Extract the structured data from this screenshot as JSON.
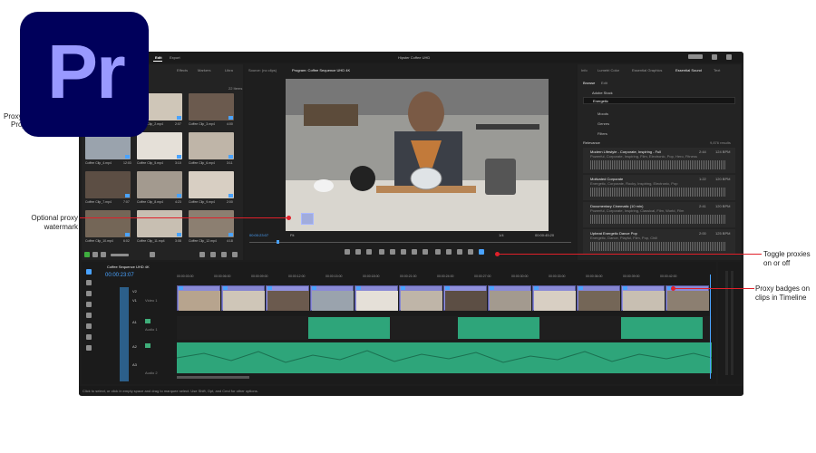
{
  "logo": {
    "text": "Pr"
  },
  "window": {
    "title": "Hipster Coffee UHD"
  },
  "header": {
    "tabs": [
      "Edit",
      "Export"
    ],
    "active_tab": "Edit"
  },
  "source_tabs": [
    "Effects",
    "Markers",
    "Libra"
  ],
  "program_tabs": [
    "Source: (no clips)",
    "Program: Coffee Sequence UHD 4K"
  ],
  "right_tabs": [
    "Info",
    "Lumetri Color",
    "Essential Graphics",
    "Essential Sound",
    "Text"
  ],
  "essential_sound": {
    "subtabs": [
      "Browse",
      "Edit"
    ],
    "filter": "Adobe Stock",
    "search": "Energetic",
    "filters": [
      "Moods",
      "Genres",
      "Filters"
    ],
    "results_label": "Relevance",
    "results_count": "9,876 results",
    "tracks": [
      {
        "title": "Modern Lifestyle - Corporate, Inspiring - Full",
        "sub": "Powerful, Corporate, Inspiring, Film, Electronic, Pop, Hero, Fitness",
        "dur": "2:44",
        "bpm": "124 BPM"
      },
      {
        "title": "Motivated Corporate",
        "sub": "Energetic, Corporate, Rocky, Inspiring, Electronic, Pop",
        "dur": "1:22",
        "bpm": "120 BPM"
      },
      {
        "title": "Documentary Cinematic (10 min)",
        "sub": "Powerful, Corporate, Inspiring, Classical, Film, World, Film",
        "dur": "2:41",
        "bpm": "120 BPM"
      },
      {
        "title": "Upbeat Energetic Dance Pop",
        "sub": "Energetic, Dance, Playful, Film, Pop, Chill",
        "dur": "2:00",
        "bpm": "125 BPM"
      }
    ]
  },
  "project_bin": {
    "clip_count": "22 Items",
    "clips": [
      {
        "name": "Coffee Clip_1.mp4",
        "dur": "5:00"
      },
      {
        "name": "Coffee Clip_2.mp4",
        "dur": "2:07"
      },
      {
        "name": "Coffee Clip_3.mp4",
        "dur": "4:00"
      },
      {
        "name": "Coffee Clip_4.mp4",
        "dur": "12:03"
      },
      {
        "name": "Coffee Clip_5.mp4",
        "dur": "3:10"
      },
      {
        "name": "Coffee Clip_6.mp4",
        "dur": "3:11"
      },
      {
        "name": "Coffee Clip_7.mp4",
        "dur": "7:07"
      },
      {
        "name": "Coffee Clip_8.mp4",
        "dur": "4:23"
      },
      {
        "name": "Coffee Clip_9.mp4",
        "dur": "2:00"
      },
      {
        "name": "Coffee Clip_10.mp4",
        "dur": "6:02"
      },
      {
        "name": "Coffee Clip_11.mp4",
        "dur": "3:08"
      },
      {
        "name": "Coffee Clip_12.mp4",
        "dur": "4:18"
      }
    ]
  },
  "program_monitor": {
    "timecode_left": "00:00:23:07",
    "fit": "Fit",
    "quality": "1/4",
    "timecode_right": "00:00:45:20"
  },
  "timeline": {
    "sequence": "Coffee Sequence UHD 4K",
    "timecode": "00:00:23:07",
    "ruler": [
      "00:00:03:00",
      "00:00:06:00",
      "00:00:09:00",
      "00:00:12:00",
      "00:00:15:00",
      "00:00:18:00",
      "00:00:21:00",
      "00:00:24:00",
      "00:00:27:00",
      "00:00:30:00",
      "00:00:33:00",
      "00:00:36:00",
      "00:00:39:00",
      "00:00:42:00"
    ],
    "tracks": [
      "V2",
      "V1",
      "A1",
      "A2",
      "A3"
    ],
    "track_names": [
      "Video 1",
      "Audio 1",
      "Audio 2"
    ]
  },
  "timeline_tools": {
    "label": "Timeline view"
  },
  "status_bar": "Click to select, or click in empty space and drag to marquee select. Use Shift, Opt, and Cmd for other options.",
  "callouts": {
    "proxy_watermark": "Optional proxy\nwatermark",
    "toggle_proxies": "Toggle proxies\non or off",
    "proxy_badges": "Proxy badges on\nclips in Timeline",
    "left_clip_1": "Proxy",
    "left_clip_2": "Proj"
  },
  "colors": {
    "accent": "#e0202a",
    "logo_bg": "#00005b",
    "logo_fg": "#9999ff",
    "clip_video": "#8a8ad6",
    "clip_audio": "#2ea57a"
  }
}
